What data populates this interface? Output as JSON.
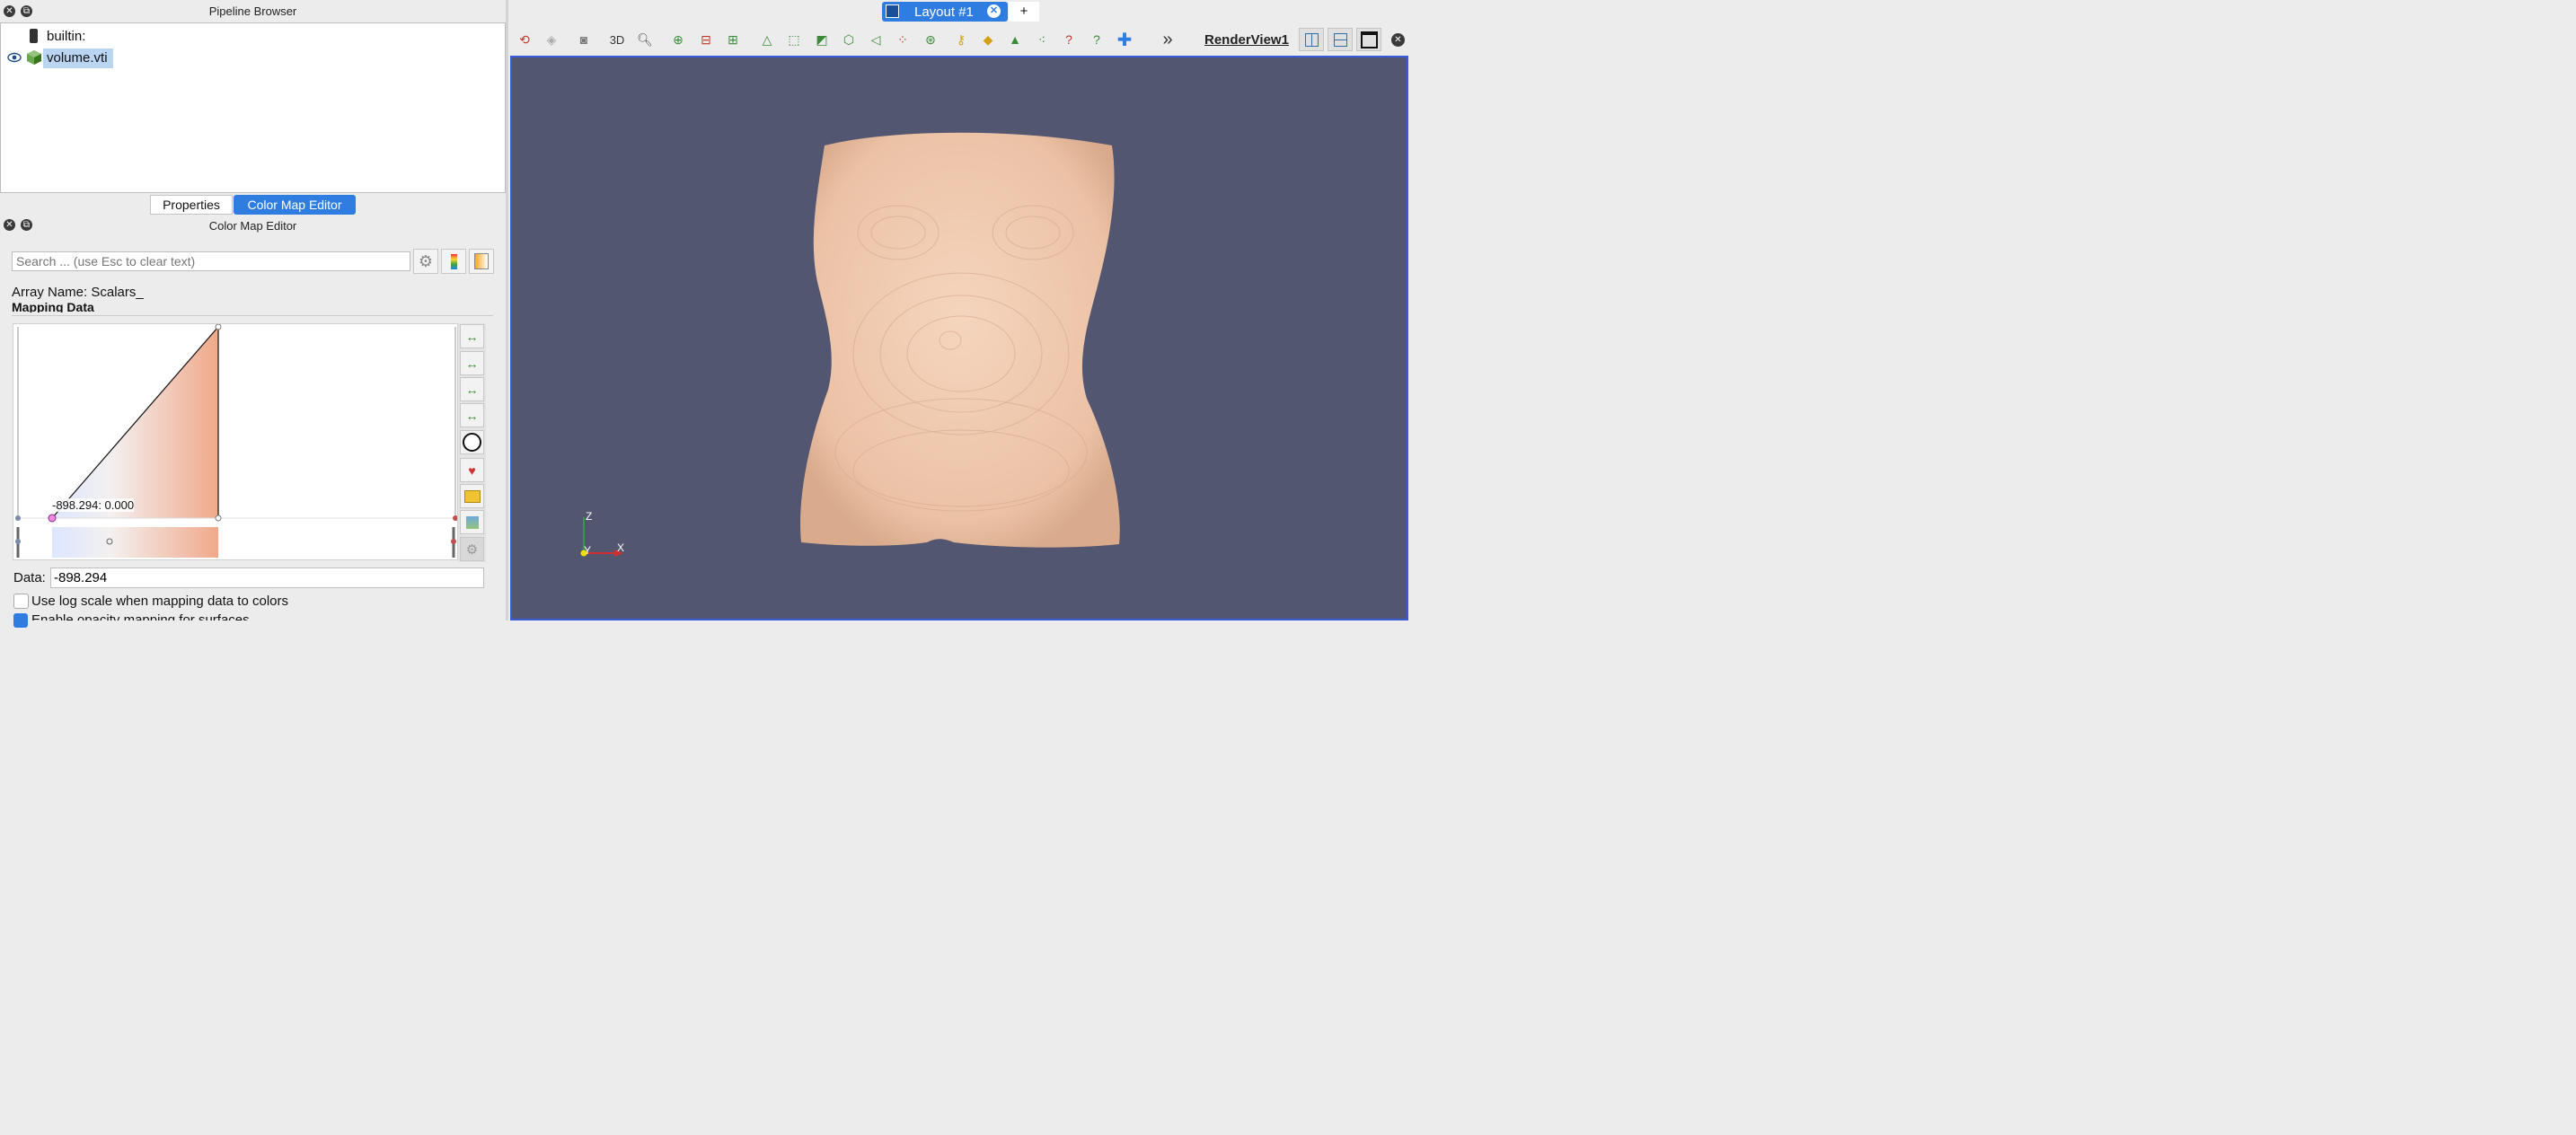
{
  "pipeline_browser": {
    "title": "Pipeline Browser",
    "items": [
      {
        "label": "builtin:",
        "icon": "server-icon"
      },
      {
        "label": "volume.vti",
        "icon": "cube-icon",
        "selected": true
      }
    ]
  },
  "panel_tabs": [
    "Properties",
    "Color Map Editor"
  ],
  "color_map_editor": {
    "title": "Color Map Editor",
    "search_placeholder": "Search ... (use Esc to clear text)",
    "array_name": "Array Name: Scalars_",
    "section": "Mapping Data",
    "tooltip": "-898.294: 0.000",
    "data_label": "Data:",
    "data_value": "-898.294",
    "checkbox_log": "Use log scale when mapping data to colors",
    "checkbox_log_checked": false,
    "checkbox_opacity_partial": "Enable opacity mapping for surfaces",
    "checkbox_opacity_checked": true
  },
  "layout_tab": {
    "label": "Layout #1",
    "add": "+"
  },
  "render_view": {
    "name": "RenderView1",
    "background": "#525670",
    "axes": {
      "z": "Z",
      "y": "Y",
      "x": "X"
    }
  },
  "toolbar": {
    "label_3d": "3D",
    "overflow": "»"
  }
}
